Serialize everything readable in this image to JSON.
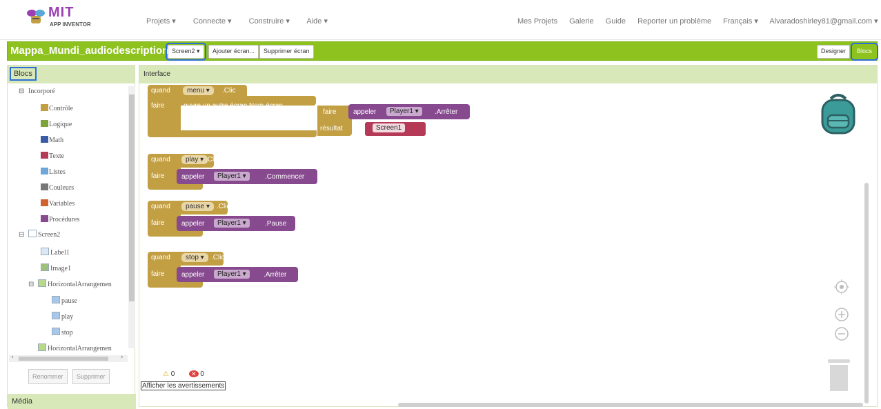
{
  "topbar": {
    "logo_title": "MIT",
    "logo_subtitle": "APP INVENTOR",
    "menu_left": [
      "Projets ▾",
      "Connecte ▾",
      "Construire ▾",
      "Aide ▾"
    ],
    "menu_right": [
      "Mes Projets",
      "Galerie",
      "Guide",
      "Reporter un problème",
      "Français ▾",
      "Alvaradoshirley81@gmail.com ▾"
    ]
  },
  "project": {
    "name": "Mappa_Mundi_audiodescription",
    "screen_select": "Screen2 ▾",
    "add_screen": "Ajouter écran...",
    "remove_screen": "Supprimer écran",
    "designer": "Designer",
    "blocks": "Blocs"
  },
  "left_panel": {
    "title": "Blocs",
    "builtin": "Incorporé",
    "categories": [
      {
        "label": "Contrôle",
        "color": "#c29f43"
      },
      {
        "label": "Logique",
        "color": "#7da33a"
      },
      {
        "label": "Math",
        "color": "#3a5ba8"
      },
      {
        "label": "Texte",
        "color": "#b53a57"
      },
      {
        "label": "Listes",
        "color": "#6fa6d8"
      },
      {
        "label": "Couleurs",
        "color": "#777777"
      },
      {
        "label": "Variables",
        "color": "#d0622e"
      },
      {
        "label": "Procédures",
        "color": "#874a8f"
      }
    ],
    "screen": "Screen2",
    "components": [
      "Label1",
      "Image1",
      "HorizontalArrangemen",
      "pause",
      "play",
      "stop",
      "HorizontalArrangemen"
    ],
    "rename": "Renommer",
    "delete": "Supprimer",
    "media": "Média"
  },
  "workspace": {
    "title": "Interface",
    "when": "quand",
    "do": "faire",
    "click": ".Clic",
    "call": "appeler",
    "blocks": [
      {
        "component": "menu ▾"
      },
      {
        "component": "play ▾",
        "player": "Player1 ▾",
        "method": ".Commencer"
      },
      {
        "component": "pause ▾",
        "player": "Player1 ▾",
        "method": ".Pause"
      },
      {
        "component": "stop ▾",
        "player": "Player1 ▾",
        "method": ".Arrêter"
      }
    ],
    "open_screen": "ouvre un autre écran  Nom écran",
    "do_inner": "faire",
    "inner_player": "Player1 ▾",
    "inner_method": ".Arrêter",
    "result": "résultat",
    "screen_text": "Screen1",
    "warnings": "0",
    "errors": "0",
    "show_warnings": "Afficher les avertissements"
  }
}
